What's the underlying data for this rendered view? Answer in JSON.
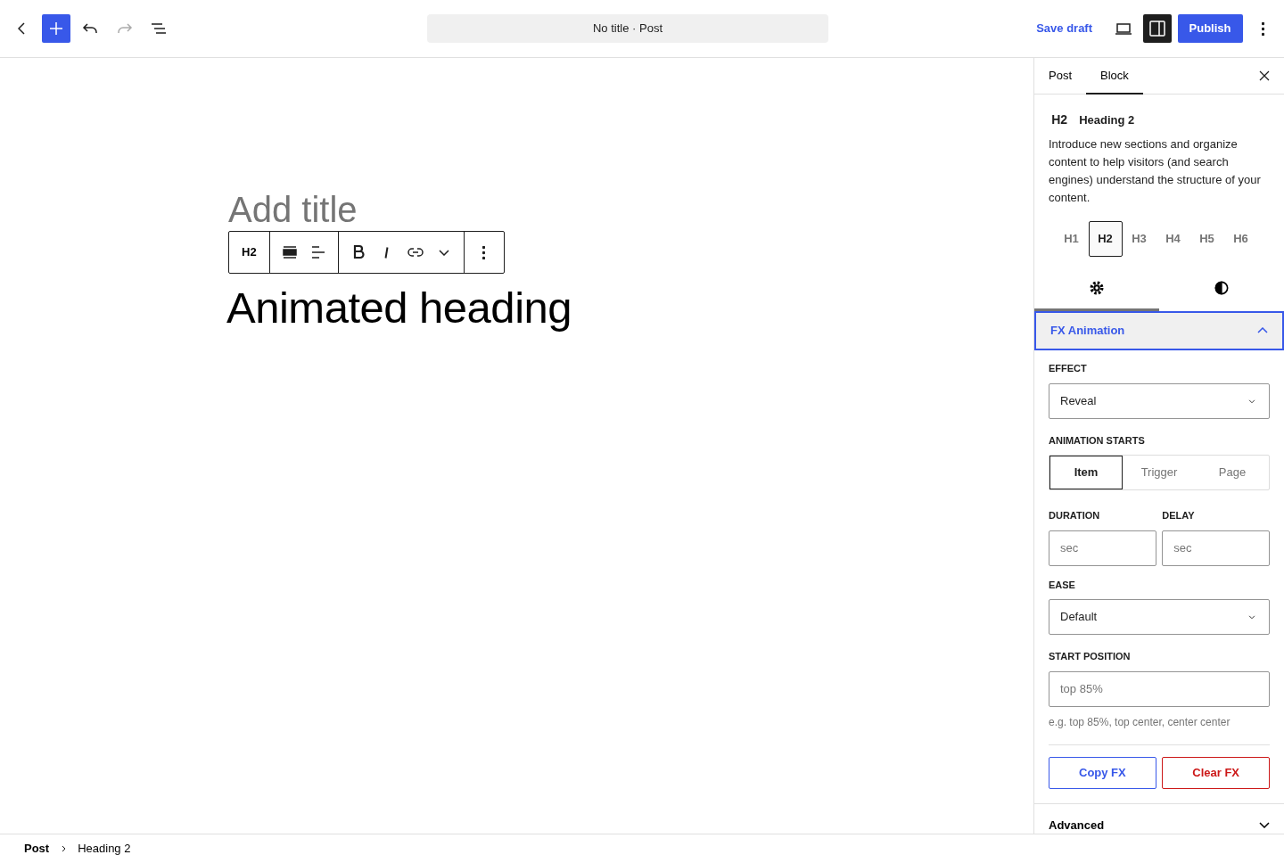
{
  "header": {
    "redo_enabled": false,
    "document_title": "No title · Post",
    "save_draft": "Save draft",
    "publish": "Publish",
    "settings_pressed": true
  },
  "editor": {
    "title_placeholder": "Add title",
    "toolbar_block_type": "H2",
    "heading": "Animated heading"
  },
  "sidebar": {
    "tabs": [
      {
        "label": "Post",
        "selected": false
      },
      {
        "label": "Block",
        "selected": true
      }
    ],
    "block_card": {
      "abbr": "H2",
      "name": "Heading 2",
      "description": "Introduce new sections and organize content to help visitors (and search engines) understand the structure of your content."
    },
    "levels": [
      {
        "label": "H1",
        "selected": false
      },
      {
        "label": "H2",
        "selected": true
      },
      {
        "label": "H3",
        "selected": false
      },
      {
        "label": "H4",
        "selected": false
      },
      {
        "label": "H5",
        "selected": false
      },
      {
        "label": "H6",
        "selected": false
      }
    ],
    "panel_tabs": [
      {
        "kind": "settings",
        "selected": true
      },
      {
        "kind": "styles",
        "selected": false
      }
    ],
    "fx_panel": {
      "title": "FX Animation",
      "expanded": true,
      "effect": {
        "label": "EFFECT",
        "value": "Reveal"
      },
      "animation_starts": {
        "label": "ANIMATION STARTS",
        "options": [
          {
            "label": "Item",
            "selected": true
          },
          {
            "label": "Trigger",
            "selected": false
          },
          {
            "label": "Page",
            "selected": false
          }
        ]
      },
      "duration": {
        "label": "DURATION",
        "placeholder": "sec"
      },
      "delay": {
        "label": "DELAY",
        "placeholder": "sec"
      },
      "ease": {
        "label": "EASE",
        "value": "Default"
      },
      "start_position": {
        "label": "START POSITION",
        "placeholder": "top 85%",
        "help": "e.g. top 85%, top center, center center"
      },
      "copy_button": "Copy FX",
      "clear_button": "Clear FX"
    },
    "advanced": {
      "title": "Advanced",
      "expanded": false
    }
  },
  "breadcrumbs": [
    "Post",
    "Heading 2"
  ]
}
